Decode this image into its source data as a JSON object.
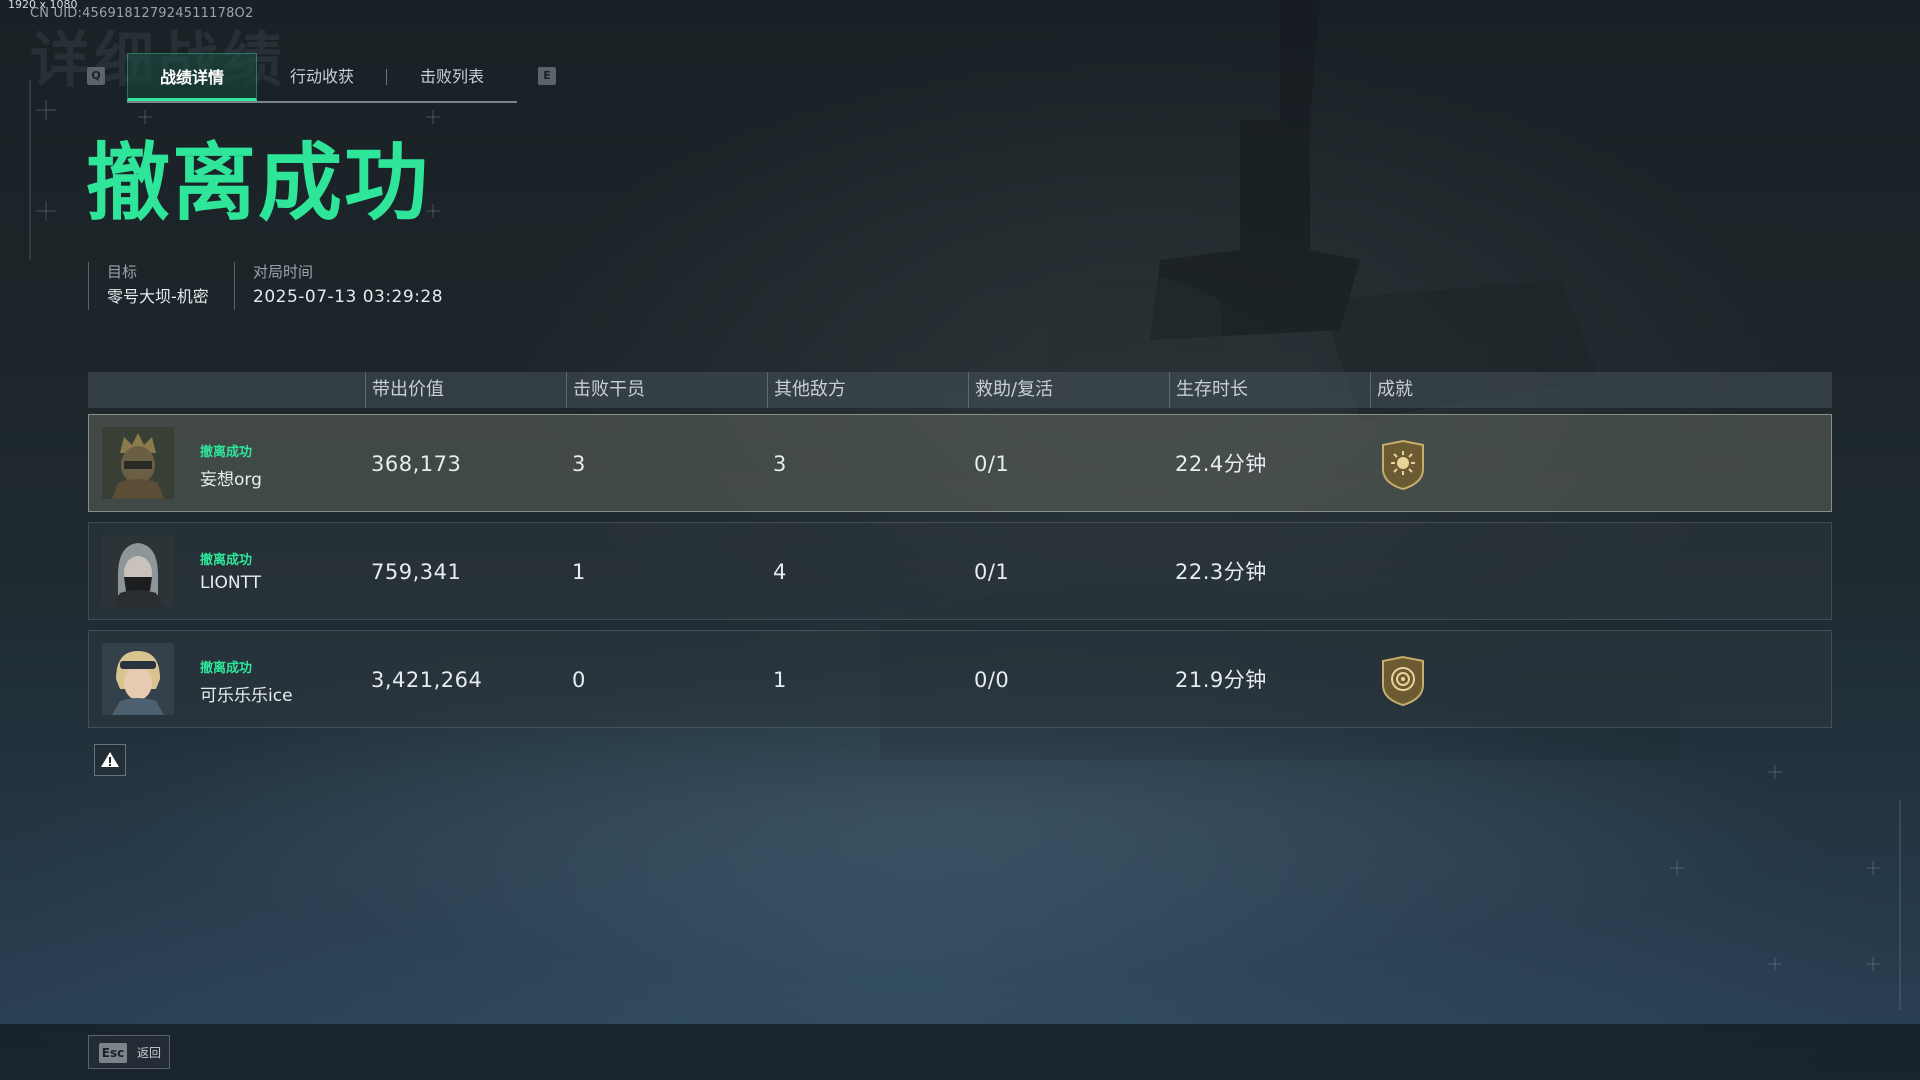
{
  "overlay": {
    "resolution": "1920 x 1080",
    "uid": "CN UID:456918127924511178O2"
  },
  "background_title": "详细战绩",
  "tabs": {
    "prev_key": "Q",
    "next_key": "E",
    "items": [
      {
        "label": "战绩详情",
        "active": true
      },
      {
        "label": "行动收获",
        "active": false
      },
      {
        "label": "击败列表",
        "active": false
      }
    ]
  },
  "result": {
    "headline": "撤离成功",
    "headline_color": "#2fe59a"
  },
  "match_info": {
    "target_label": "目标",
    "target_value": "零号大坝-机密",
    "time_label": "对局时间",
    "time_value": "2025-07-13 03:29:28"
  },
  "table": {
    "headers": [
      "带出价值",
      "击败干员",
      "其他敌方",
      "救助/复活",
      "生存时长",
      "成就"
    ],
    "rows": [
      {
        "status": "撤离成功",
        "name": "妄想org",
        "value": "368,173",
        "operator_kills": "3",
        "other_kills": "3",
        "assist_revive": "0/1",
        "survival": "22.4分钟",
        "achievement": "sun-emblem-icon",
        "highlight": true
      },
      {
        "status": "撤离成功",
        "name": "LIONTT",
        "value": "759,341",
        "operator_kills": "1",
        "other_kills": "4",
        "assist_revive": "0/1",
        "survival": "22.3分钟",
        "achievement": "",
        "highlight": false
      },
      {
        "status": "撤离成功",
        "name": "可乐乐乐ice",
        "value": "3,421,264",
        "operator_kills": "0",
        "other_kills": "1",
        "assist_revive": "0/0",
        "survival": "21.9分钟",
        "achievement": "target-emblem-icon",
        "highlight": false
      }
    ]
  },
  "report_button_icon": "warning-icon",
  "footer": {
    "esc_key": "Esc",
    "back_label": "返回"
  }
}
